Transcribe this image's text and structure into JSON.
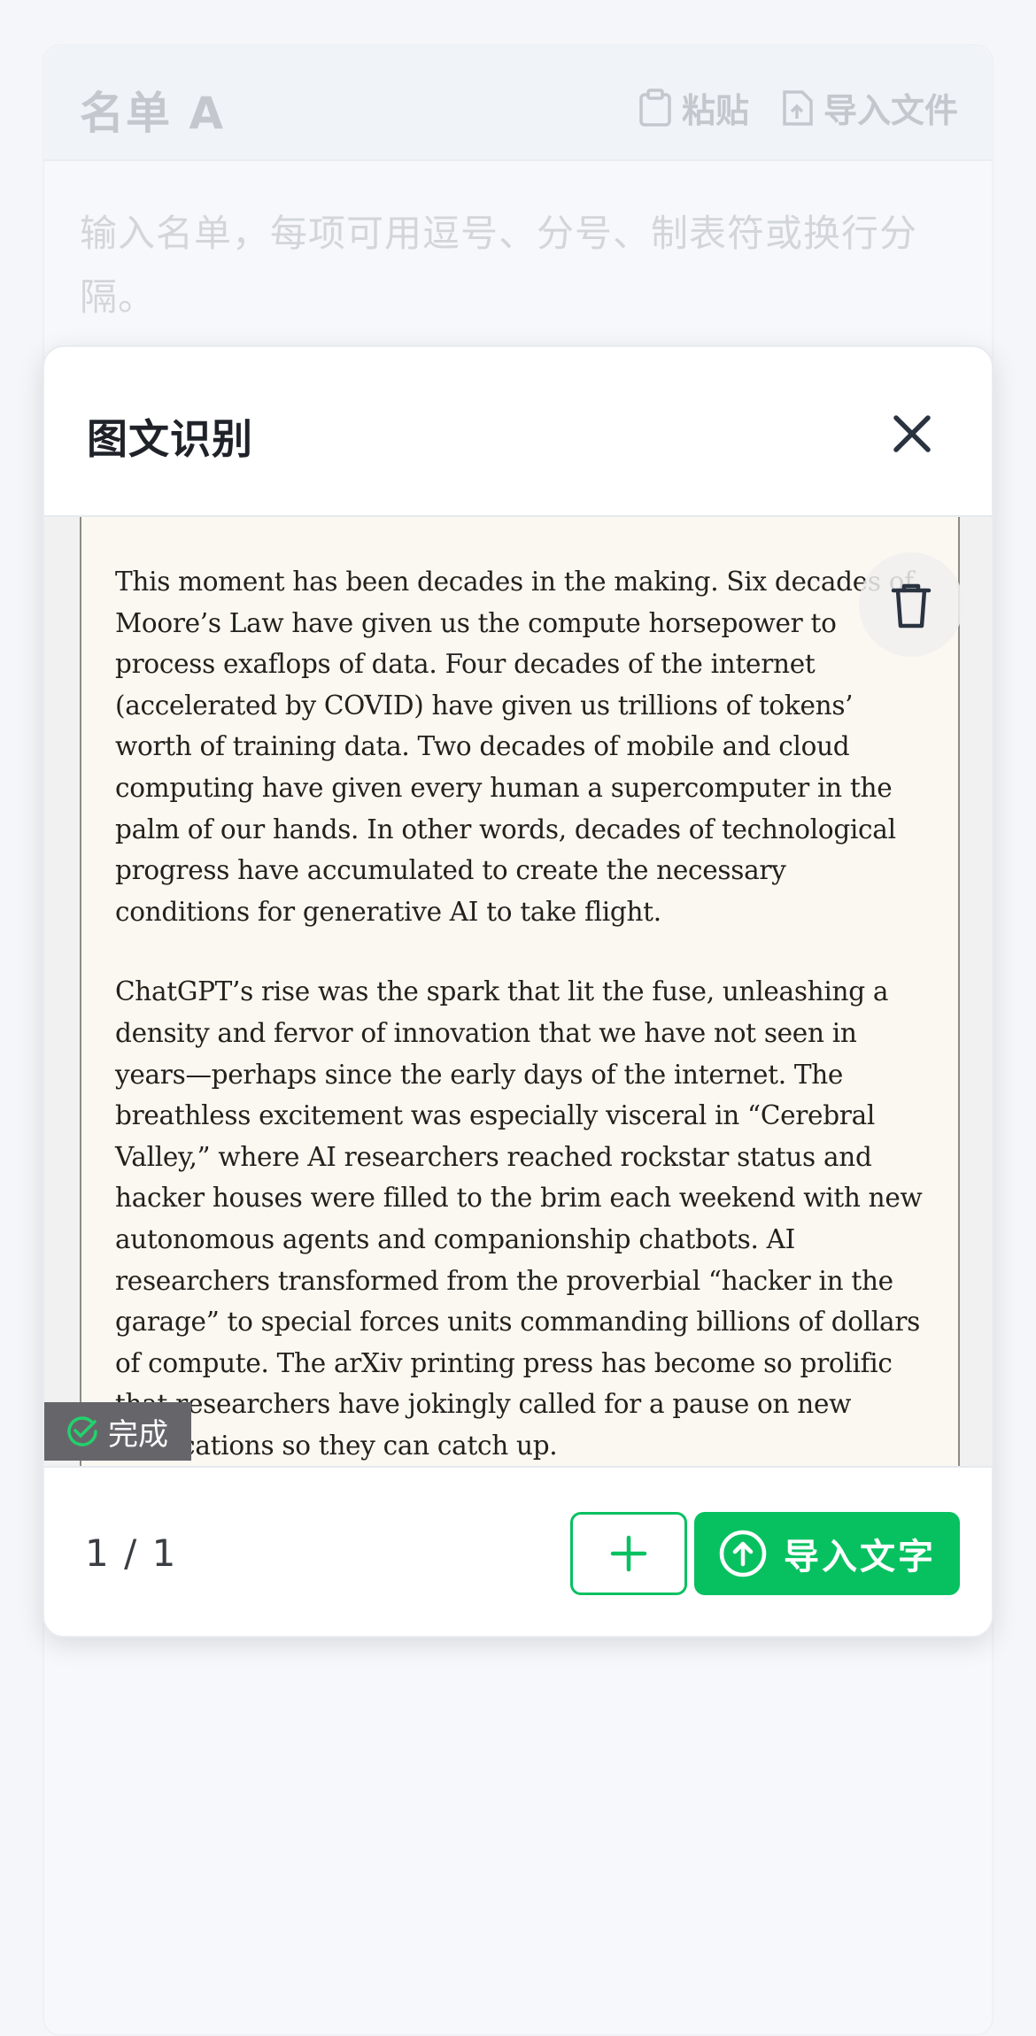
{
  "background": {
    "title": "名单 A",
    "paste_label": "粘贴",
    "import_file_label": "导入文件",
    "placeholder": "输入名单，每项可用逗号、分号、制表符或换行分隔。"
  },
  "modal": {
    "title": "图文识别",
    "image_text": {
      "paragraph1": "This moment has been decades in the making. Six decades of Moore’s Law have given us the compute horsepower to process exaflops of data. Four decades of the internet (accelerated by COVID) have given us trillions of tokens’ worth of training data. Two decades of mobile and cloud computing have given every human a supercomputer in the palm of our hands. In other words, decades of technological progress have accumulated to create the necessary conditions for generative AI to take flight.",
      "paragraph2": "ChatGPT’s rise was the spark that lit the fuse, unleashing a density and fervor of innovation that we have not seen in years—perhaps since the early days of the internet. The breathless excitement was especially visceral in “Cerebral Valley,” where AI researchers reached rockstar status and hacker houses were filled to the brim each weekend with new autonomous agents and companionship chatbots. AI researchers transformed from the proverbial “hacker in the garage” to special forces units commanding billions of dollars of compute. The arXiv printing press has become so prolific that researchers have jokingly called for a pause on new publications so they can catch up."
    },
    "status_label": "完成",
    "page_indicator": "1 / 1",
    "import_text_label": "导入文字"
  },
  "colors": {
    "accent": "#07c160",
    "status_badge_bg": "#66666a"
  },
  "icons": [
    "clipboard-icon",
    "file-upload-icon",
    "close-icon",
    "trash-icon",
    "check-circle-icon",
    "plus-icon",
    "upload-circle-icon"
  ]
}
